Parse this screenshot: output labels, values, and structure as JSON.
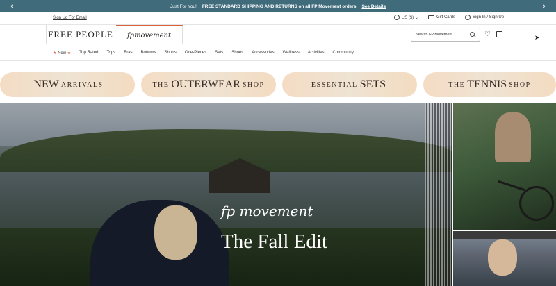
{
  "promo": {
    "left_arrow": "‹",
    "right_arrow": "›",
    "just_for_you": "Just For You!",
    "offer": "FREE STANDARD SHIPPING AND RETURNS on all FP Movement orders",
    "details": "See Details"
  },
  "utility": {
    "signup": "Sign Up For Email",
    "currency": "US ($) ⌄",
    "gift_cards": "Gift Cards",
    "sign_in": "Sign In / Sign Up"
  },
  "header": {
    "brand": "FREE PEOPLE",
    "sub_brand": "fpmovement",
    "search_placeholder": "Search FP Movement",
    "heart_glyph": "♡",
    "cursor_glyph": "➤"
  },
  "nav": {
    "new_label": "New",
    "star": "★",
    "items": [
      "Top Rated",
      "Tops",
      "Bras",
      "Bottoms",
      "Shorts",
      "One-Pieces",
      "Sets",
      "Shoes",
      "Accessories",
      "Wellness",
      "Activities",
      "Community"
    ]
  },
  "banners": [
    {
      "big": "NEW",
      "rest": "ARRIVALS",
      "prefix": ""
    },
    {
      "prefix": "THE",
      "big": "OUTERWEAR",
      "rest": "SHOP"
    },
    {
      "prefix": "ESSENTIAL",
      "big": "SETS",
      "rest": ""
    },
    {
      "prefix": "THE",
      "big": "TENNIS",
      "rest": "SHOP"
    }
  ],
  "hero": {
    "script": "fp movement",
    "title": "The Fall Edit"
  },
  "colors": {
    "promo_bg": "#3f6b7b",
    "accent": "#d8603c",
    "pill_bg": "#f3dec7"
  }
}
